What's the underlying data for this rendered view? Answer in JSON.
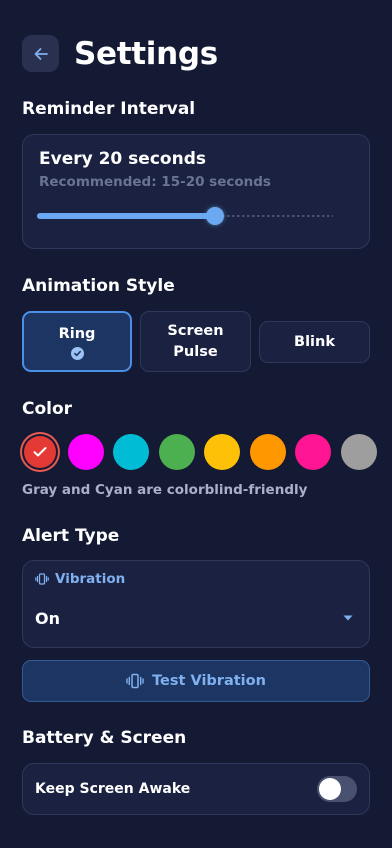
{
  "header": {
    "back_icon": "arrow-left-icon",
    "title": "Settings"
  },
  "reminder": {
    "section_title": "Reminder Interval",
    "value_label": "Every 20 seconds",
    "hint": "Recommended: 15-20 seconds",
    "slider_fraction": 0.6
  },
  "animation": {
    "section_title": "Animation Style",
    "options": [
      {
        "line1": "Ring",
        "line2": "",
        "selected": true
      },
      {
        "line1": "Screen",
        "line2": "Pulse",
        "selected": false
      },
      {
        "line1": "Blink",
        "line2": "",
        "selected": false
      }
    ]
  },
  "color": {
    "section_title": "Color",
    "swatches": [
      "#e53935",
      "#ff00ff",
      "#00bcd4",
      "#4caf50",
      "#ffc107",
      "#ff9800",
      "#ff1493",
      "#9e9e9e"
    ],
    "selected_index": 0,
    "hint": "Gray and Cyan are colorblind-friendly"
  },
  "alert": {
    "section_title": "Alert Type",
    "field_label": "Vibration",
    "field_icon": "vibration-icon",
    "value": "On",
    "test_button": "Test Vibration"
  },
  "battery": {
    "section_title": "Battery & Screen",
    "keep_awake_label": "Keep Screen Awake",
    "keep_awake_on": false
  },
  "colors": {
    "background": "#141a33",
    "card": "#1b2241",
    "accent": "#6aa9f2",
    "selected_bg": "#1d3562"
  }
}
